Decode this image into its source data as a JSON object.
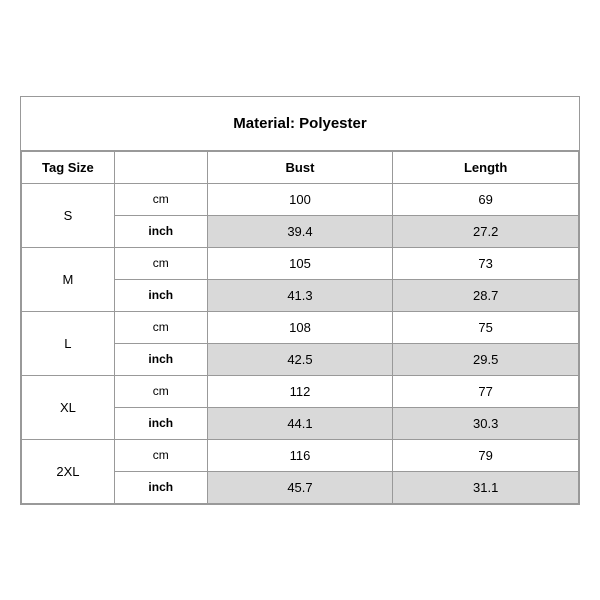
{
  "title": "Material: Polyester",
  "headers": {
    "tag_size": "Tag Size",
    "bust": "Bust",
    "length": "Length"
  },
  "sizes": [
    {
      "label": "S",
      "cm_bust": "100",
      "cm_length": "69",
      "inch_bust": "39.4",
      "inch_length": "27.2"
    },
    {
      "label": "M",
      "cm_bust": "105",
      "cm_length": "73",
      "inch_bust": "41.3",
      "inch_length": "28.7"
    },
    {
      "label": "L",
      "cm_bust": "108",
      "cm_length": "75",
      "inch_bust": "42.5",
      "inch_length": "29.5"
    },
    {
      "label": "XL",
      "cm_bust": "112",
      "cm_length": "77",
      "inch_bust": "44.1",
      "inch_length": "30.3"
    },
    {
      "label": "2XL",
      "cm_bust": "116",
      "cm_length": "79",
      "inch_bust": "45.7",
      "inch_length": "31.1"
    }
  ],
  "unit_cm": "cm",
  "unit_inch": "inch"
}
